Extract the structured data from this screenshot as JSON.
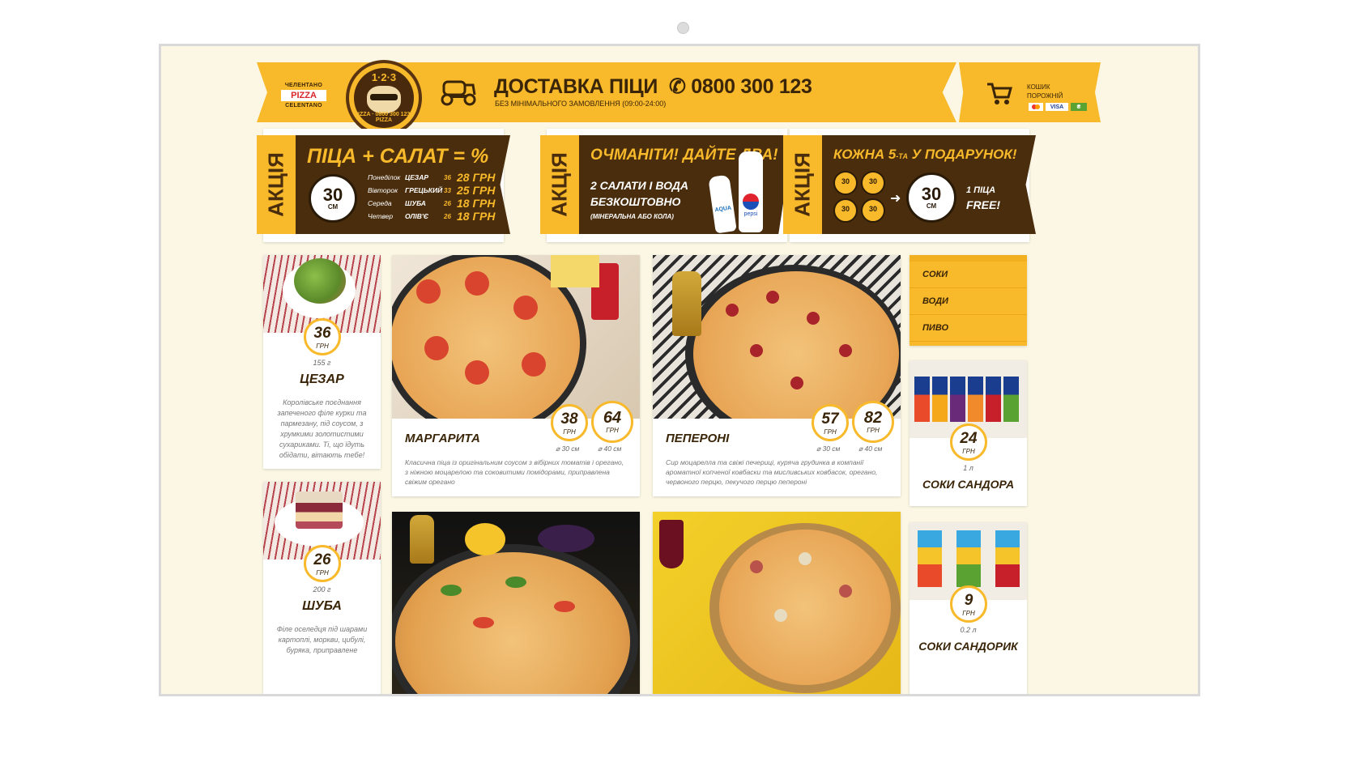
{
  "header": {
    "brand_top": "ЧЕЛЕНТАНО",
    "brand_mid": "PIZZA",
    "brand_bottom": "CELENTANO",
    "logo_number": "1·2·3",
    "logo_phone": "PIZZA · 0800 300 123 · PIZZA",
    "title": "ДОСТАВКА ПІЦИ",
    "phone": "0800 300 123",
    "subtitle": "БЕЗ МІНІМАЛЬНОГО ЗАМОВЛЕННЯ (09:00-24:00)",
    "cart_line1": "КОШИК",
    "cart_line2": "ПОРОЖНІЙ",
    "pay_visa": "VISA"
  },
  "promos": [
    {
      "tag": "АКЦІЯ",
      "title": "ПІЦА + САЛАТ = %",
      "badge_num": "30",
      "badge_unit": "СМ",
      "schedule": [
        {
          "day": "Понеділок",
          "item": "ЦЕЗАР",
          "old": "36",
          "new": "28 ГРН"
        },
        {
          "day": "Вівторок",
          "item": "ГРЕЦЬКИЙ",
          "old": "33",
          "new": "25 ГРН"
        },
        {
          "day": "Середа",
          "item": "ШУБА",
          "old": "26",
          "new": "18 ГРН"
        },
        {
          "day": "Четвер",
          "item": "ОЛІВ'Є",
          "old": "26",
          "new": "18 ГРН"
        }
      ]
    },
    {
      "tag": "АКЦІЯ",
      "title": "ОЧМАНІТИ! ДАЙТЕ ДВА!",
      "line1": "2 САЛАТИ І ВОДА",
      "line2": "БЕЗКОШТОВНО",
      "line3": "(МІНЕРАЛЬНА АБО КОЛА)",
      "bottle1": "AQUA",
      "bottle2": "pepsi"
    },
    {
      "tag": "АКЦІЯ",
      "title": "КОЖНА 5",
      "title_sup": "-ТА",
      "title_end": " У ПОДАРУНОК!",
      "badge_num": "30",
      "badge_unit": "СМ",
      "line1": "1 ПІЦА",
      "line2": "FREE!"
    }
  ],
  "salads": [
    {
      "price": "36",
      "unit": "ГРН",
      "weight": "155 г",
      "name": "ЦЕЗАР",
      "desc": "Королівське поєднання запеченого філе курки та пармезану, під соусом, з хрумкими золотистими сухариками. Ті, що їдуть обідати, вітають тебе!"
    },
    {
      "price": "26",
      "unit": "ГРН",
      "weight": "200 г",
      "name": "ШУБА",
      "desc": "Філе оселедця під шарами картоплі, моркви, цибулі, буряка, приправлене"
    }
  ],
  "pizzas": [
    {
      "name": "МАРГАРИТА",
      "price_small": "38",
      "price_large": "64",
      "unit": "ГРН",
      "size_small": "⌀ 30 см",
      "size_large": "⌀ 40 см",
      "desc": "Класична піца із оригінальним соусом з вібірних томатів і орегано, з ніжною моцарелою та соковитими помідорами, приправлена свіжим орегано"
    },
    {
      "name": "ПЕПЕРОНІ",
      "price_small": "57",
      "price_large": "82",
      "unit": "ГРН",
      "size_small": "⌀ 30 см",
      "size_large": "⌀ 40 см",
      "desc": "Сир моцарелла та свіжі печериці, куряча грудинка в компанії ароматної копченої ковбаски та мисливських ковбасок, орегано, червоного перцю, пекучого перцю пепероні"
    }
  ],
  "menu": {
    "items": [
      "СОКИ",
      "ВОДИ",
      "ПИВО"
    ]
  },
  "drinks": [
    {
      "price": "24",
      "unit": "ГРН",
      "volume": "1 л",
      "name": "СОКИ САНДОРА"
    },
    {
      "price": "9",
      "unit": "ГРН",
      "volume": "0.2 л",
      "name": "СОКИ САНДОРИК"
    }
  ],
  "colors": {
    "accent": "#f8b92a",
    "brown": "#4a2d0c",
    "background": "#fbf7e4"
  }
}
